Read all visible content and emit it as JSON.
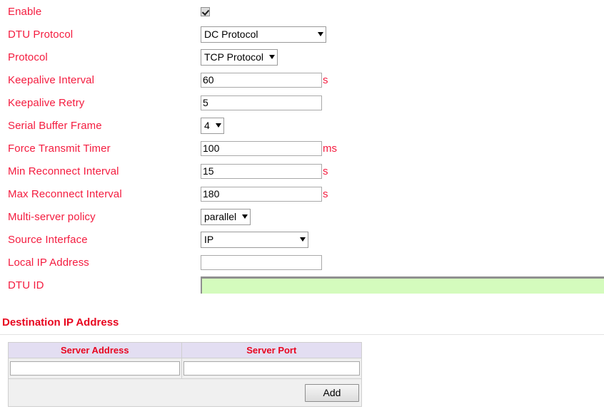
{
  "form": {
    "rows": [
      {
        "label": "Enable",
        "control": "checkbox",
        "checked": true,
        "unit": ""
      },
      {
        "label": "DTU Protocol",
        "control": "select",
        "value": "DC Protocol",
        "unit": ""
      },
      {
        "label": "Protocol",
        "control": "select",
        "value": "TCP Protocol",
        "unit": ""
      },
      {
        "label": "Keepalive Interval",
        "control": "text",
        "value": "60",
        "unit": "s"
      },
      {
        "label": "Keepalive Retry",
        "control": "text",
        "value": "5",
        "unit": ""
      },
      {
        "label": "Serial Buffer Frame",
        "control": "select",
        "value": "4",
        "unit": ""
      },
      {
        "label": "Force Transmit Timer",
        "control": "text",
        "value": "100",
        "unit": "ms"
      },
      {
        "label": "Min Reconnect Interval",
        "control": "text",
        "value": "15",
        "unit": "s"
      },
      {
        "label": "Max Reconnect Interval",
        "control": "text",
        "value": "180",
        "unit": "s"
      },
      {
        "label": "Multi-server policy",
        "control": "select",
        "value": "parallel",
        "unit": ""
      },
      {
        "label": "Source Interface",
        "control": "select",
        "value": "IP",
        "unit": ""
      },
      {
        "label": "Local IP Address",
        "control": "text",
        "value": "",
        "unit": ""
      },
      {
        "label": "DTU ID",
        "control": "text-wide",
        "value": "",
        "unit": ""
      }
    ],
    "labels": {
      "enable": "Enable",
      "dtu_protocol": "DTU Protocol",
      "protocol": "Protocol",
      "keepalive_interval": "Keepalive Interval",
      "keepalive_retry": "Keepalive Retry",
      "serial_buffer_frame": "Serial Buffer Frame",
      "force_transmit_timer": "Force Transmit Timer",
      "min_reconnect_interval": "Min Reconnect Interval",
      "max_reconnect_interval": "Max Reconnect Interval",
      "multi_server_policy": "Multi-server policy",
      "source_interface": "Source Interface",
      "local_ip_address": "Local IP Address",
      "dtu_id": "DTU ID"
    },
    "values": {
      "dtu_protocol": "DC Protocol",
      "protocol": "TCP Protocol",
      "keepalive_interval": "60",
      "keepalive_retry": "5",
      "serial_buffer_frame": "4",
      "force_transmit_timer": "100",
      "min_reconnect_interval": "15",
      "max_reconnect_interval": "180",
      "multi_server_policy": "parallel",
      "source_interface": "IP",
      "local_ip_address": "",
      "dtu_id": ""
    },
    "units": {
      "keepalive_interval": "s",
      "force_transmit_timer": "ms",
      "min_reconnect_interval": "s",
      "max_reconnect_interval": "s"
    }
  },
  "destination": {
    "heading": "Destination IP Address",
    "columns": [
      "Server Address",
      "Server Port"
    ],
    "rows": [
      {
        "server_address": "",
        "server_port": ""
      }
    ],
    "add_label": "Add"
  },
  "colors": {
    "label_red": "#f41c3f",
    "heading_red": "#e8051f",
    "table_header_bg": "#e3def2",
    "dtu_id_bg": "#d4fbbd"
  }
}
